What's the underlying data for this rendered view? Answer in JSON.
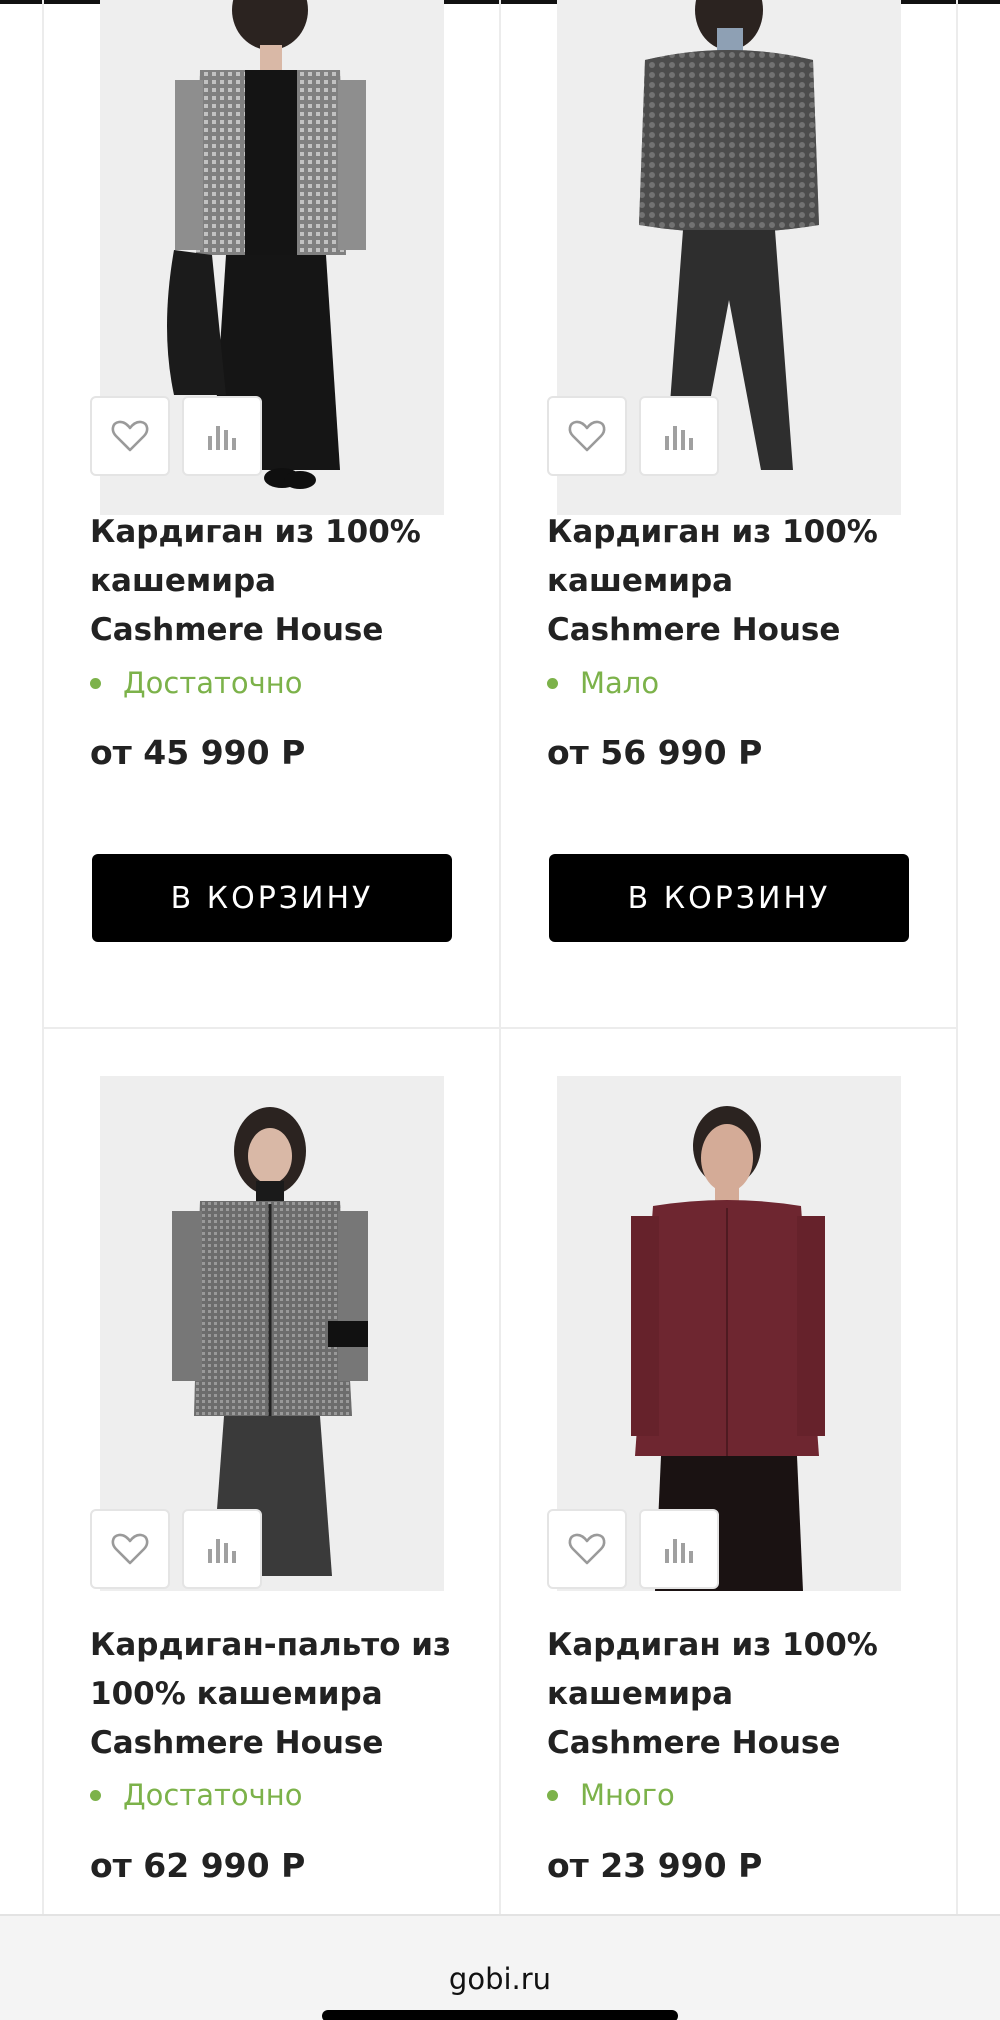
{
  "products": [
    {
      "title_line1": "Кардиган из 100%",
      "title_line2": "кашемира",
      "title_line3": "Cashmere House",
      "stock": "Достаточно",
      "price": "от 45 990 Р",
      "cart_label": "В КОРЗИНУ",
      "image": "grey-tweed-cardigan-model"
    },
    {
      "title_line1": "Кардиган из 100%",
      "title_line2": "кашемира",
      "title_line3": "Cashmere House",
      "stock": "Мало",
      "price": "от 56 990 Р",
      "cart_label": "В КОРЗИНУ",
      "image": "dark-grey-boucle-cardigan-model"
    },
    {
      "title_line1": "Кардиган-пальто из",
      "title_line2": "100% кашемира",
      "title_line3": "Cashmere House",
      "stock": "Достаточно",
      "price": "от 62 990 Р",
      "image": "grey-cardigan-coat-model"
    },
    {
      "title_line1": "Кардиган из 100%",
      "title_line2": "кашемира",
      "title_line3": "Cashmere House",
      "stock": "Много",
      "price": "от 23 990 Р",
      "image": "burgundy-cardigan-model"
    }
  ],
  "icons": {
    "favorite": "heart-icon",
    "compare": "bar-chart-icon"
  },
  "browser": {
    "url": "gobi.ru"
  },
  "colors": {
    "accent_green": "#7cb24a",
    "button_black": "#000000",
    "text_dark": "#222222"
  }
}
